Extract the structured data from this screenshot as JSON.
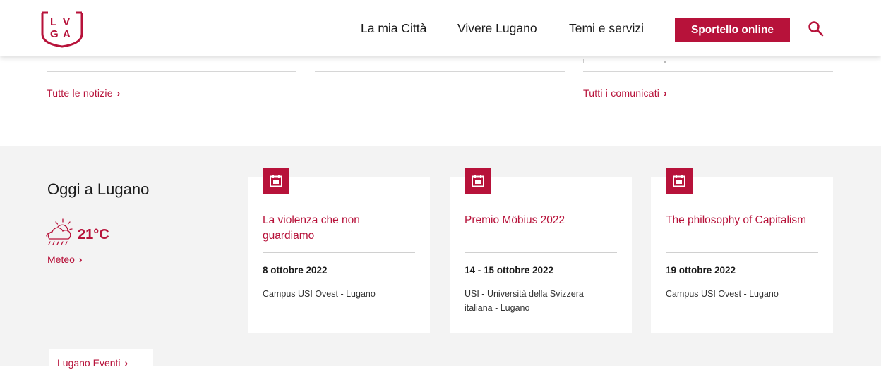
{
  "header": {
    "logo_text": "LVGA",
    "nav": [
      "La mia Città",
      "Vivere Lugano",
      "Temi e servizi"
    ],
    "cta_label": "Sportello online"
  },
  "news": {
    "all_news_link": "Tutte le notizie",
    "all_communications_link": "Tutti i comunicati"
  },
  "today": {
    "title": "Oggi a Lugano",
    "temperature": "21°C",
    "weather_icon": "partly-cloudy-rain-icon",
    "meteo_link": "Meteo"
  },
  "events": [
    {
      "title": "La violenza che non guardiamo",
      "date": "8 ottobre 2022",
      "place": "Campus USI Ovest - Lugano"
    },
    {
      "title": "Premio Möbius 2022",
      "date": "14 - 15 ottobre 2022",
      "place": "USI - Università della Svizzera italiana - Lugano"
    },
    {
      "title": "The philosophy of Capitalism",
      "date": "19 ottobre 2022",
      "place": "Campus USI Ovest - Lugano"
    }
  ],
  "events_link": "Lugano Eventi",
  "colors": {
    "accent": "#b7123a",
    "section_bg": "#f3f3f3"
  }
}
